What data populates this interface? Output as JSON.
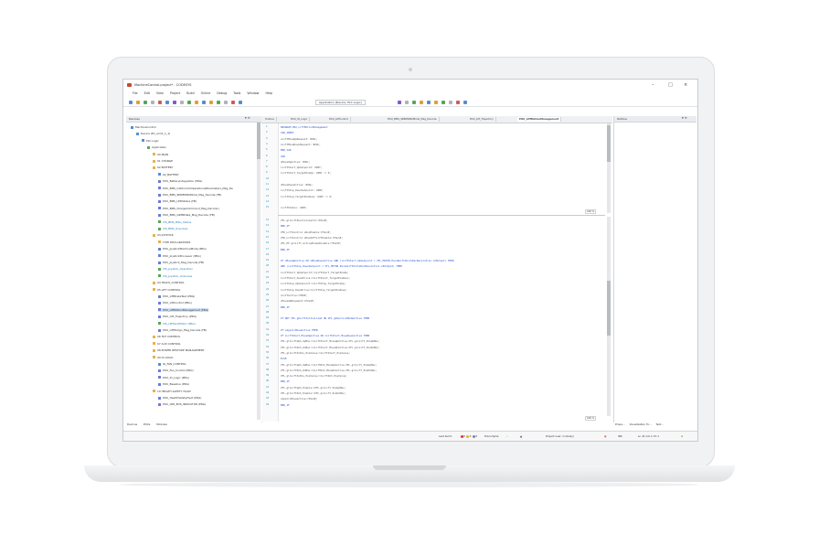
{
  "window": {
    "title": "MachineControl.project* - CODESYS",
    "controls": [
      "–",
      "□",
      "×"
    ]
  },
  "menu": [
    "File",
    "Edit",
    "View",
    "Project",
    "Build",
    "Online",
    "Debug",
    "Tools",
    "Window",
    "Help"
  ],
  "toolbar": {
    "application_selector": "Application [Device: PLC Logic]"
  },
  "devices_panel": {
    "title": "Devices",
    "tree": [
      {
        "label": "MachineControl",
        "icon": "project-icon",
        "indent": 0
      },
      {
        "label": "Device (E1_arm1_1_1)",
        "icon": "device-icon",
        "indent": 1
      },
      {
        "label": "PLC Logic",
        "icon": "plc-icon",
        "indent": 2
      },
      {
        "label": "Application",
        "icon": "app-icon",
        "indent": 3
      },
      {
        "label": "00 MAIN",
        "icon": "folder-icon",
        "indent": 4
      },
      {
        "label": "01 CHANGE",
        "icon": "folder-icon",
        "indent": 4
      },
      {
        "label": "02 BATTERY",
        "icon": "folder-icon",
        "indent": 4
      },
      {
        "label": "02_BATTERY",
        "icon": "gvl-icon",
        "indent": 5
      },
      {
        "label": "POU_BatteryIntegration (PRG)",
        "icon": "pou-icon",
        "indent": 5
      },
      {
        "label": "POU_BMS_CANcommOperationalParameters_Msg_De",
        "icon": "pou-icon",
        "indent": 5
      },
      {
        "label": "POU_BMS_SERIERNUMmal_Msg_Decode (FB)",
        "icon": "pou-icon",
        "indent": 5
      },
      {
        "label": "POU_BMS_LEDStatus (FB)",
        "icon": "pou-icon",
        "indent": 5
      },
      {
        "label": "POU_BMS_ChargeCommand_Msg_Decode (",
        "icon": "pou-icon",
        "indent": 5
      },
      {
        "label": "POU_BMS_GIMMDate_Msg_Decode (FB)",
        "icon": "pou-icon",
        "indent": 5
      },
      {
        "label": "VIS_BMS_MSG_Status",
        "icon": "vis-icon",
        "indent": 5
      },
      {
        "label": "VIS_BMS_Overview",
        "icon": "vis-icon",
        "indent": 5
      },
      {
        "label": "03 JOYSTICK",
        "icon": "folder-icon",
        "indent": 4
      },
      {
        "label": "TYPE DECLARATIONS",
        "icon": "folder-icon",
        "indent": 5
      },
      {
        "label": "POU_JoystickMachineMode (PRG)",
        "icon": "pou-icon",
        "indent": 5
      },
      {
        "label": "POU_JoystickProcessor (PRG)",
        "icon": "pou-icon",
        "indent": 5
      },
      {
        "label": "POU_Joystick_Msg_Decode (FB)",
        "icon": "pou-icon",
        "indent": 5
      },
      {
        "label": "VIS_Joystick_Operation",
        "icon": "vis-icon",
        "indent": 5
      },
      {
        "label": "VIS_Joystick_Overview",
        "icon": "vis-icon",
        "indent": 5
      },
      {
        "label": "04 TRACK_CONTROL",
        "icon": "folder-icon",
        "indent": 4
      },
      {
        "label": "05 LIFT CONTROL",
        "icon": "folder-icon",
        "indent": 4
      },
      {
        "label": "POU_LiftBrakeTest (PRG)",
        "icon": "pou-icon",
        "indent": 5
      },
      {
        "label": "POU_LiftControl (PRG)",
        "icon": "pou-icon",
        "indent": 5
      },
      {
        "label": "POU_LiftMotionManagement (PRG)",
        "icon": "pou-icon",
        "indent": 5,
        "selected": true
      },
      {
        "label": "POU_Lift_Trajectory (PRG)",
        "icon": "pou-icon",
        "indent": 5
      },
      {
        "label": "VIS_LiftHandMotor (PRG)",
        "icon": "vis-icon",
        "indent": 5
      },
      {
        "label": "POU_LiftWdrgo_Msg_Decode (FB)",
        "icon": "pou-icon",
        "indent": 5
      },
      {
        "label": "06 TILT CONTROL",
        "icon": "folder-icon",
        "indent": 4
      },
      {
        "label": "07 AUX CONTROL",
        "icon": "folder-icon",
        "indent": 4
      },
      {
        "label": "08 POWER RESTORE MANAGEMENT",
        "icon": "folder-icon",
        "indent": 4
      },
      {
        "label": "09 IO LOGIC",
        "icon": "folder-icon",
        "indent": 4
      },
      {
        "label": "IO_FAN_CONTROL",
        "icon": "gvl-icon",
        "indent": 5
      },
      {
        "label": "POU_Fan_Control (PRG)",
        "icon": "pou-icon",
        "indent": 5
      },
      {
        "label": "POU_IO_Logic (PRG)",
        "icon": "pou-icon",
        "indent": 5
      },
      {
        "label": "POU_Baseline (PRG)",
        "icon": "pou-icon",
        "indent": 5
      },
      {
        "label": "10 HEALTH SAFETY FAULT",
        "icon": "folder-icon",
        "indent": 4
      },
      {
        "label": "POU_HealthSafetyFault (PRG)",
        "icon": "pou-icon",
        "indent": 5
      },
      {
        "label": "POU_LED_BUS_INDICATOR (PRG)",
        "icon": "pou-icon",
        "indent": 5
      }
    ],
    "bottom_tabs": [
      "Devices",
      "POUs",
      "Modules"
    ]
  },
  "editor": {
    "tabs": [
      "Toolbox",
      "POU_IO_Logic",
      "POU_LiftControl",
      "POU_BMS_SERIERNUMmal_Msg_Decode",
      "POU_Lift_Trajectory",
      "POU_LiftMotionManagement"
    ],
    "active_tab": "POU_LiftMotionManagement",
    "zoom_top": "100 %",
    "zoom_bottom": "100 %",
    "decl_lines": [
      {
        "n": "1",
        "t": "PROGRAM POU_LiftMotionManagement",
        "c": "kw"
      },
      {
        "n": "2",
        "t": "VAR_INPUT",
        "c": "kw"
      },
      {
        "n": "3",
        "t": "    xLiftMoveUpRequest: BOOL;",
        "c": "tx"
      },
      {
        "n": "4",
        "t": "    xLiftMoveDownRequest: BOOL;",
        "c": "tx"
      },
      {
        "n": "5",
        "t": "END_VAR",
        "c": "kw"
      },
      {
        "n": "6",
        "t": "VAR",
        "c": "kw"
      },
      {
        "n": "7",
        "t": "    xMoveUpActive: BOOL;",
        "c": "tx"
      },
      {
        "n": "8",
        "t": "    iLiftStart_UpSetpoint: UINT;",
        "c": "tx"
      },
      {
        "n": "9",
        "t": "    iLiftStart_TargetPosUp: UINT := 0;",
        "c": "tx"
      },
      {
        "n": "10",
        "t": "",
        "c": "tx"
      },
      {
        "n": "11",
        "t": "    xMoveDownActive: BOOL;",
        "c": "tx"
      },
      {
        "n": "12",
        "t": "    iLiftStop_DownSetpoint: UINT;",
        "c": "tx"
      },
      {
        "n": "13",
        "t": "    iLiftStop_TargetPosDown: UINT := 0;",
        "c": "tx"
      },
      {
        "n": "14",
        "t": "",
        "c": "tx"
      },
      {
        "n": "15",
        "t": "    iLiftStatus: UINT;",
        "c": "tx"
      }
    ],
    "impl_lines": [
      {
        "n": "12",
        "t": "    VFL.gliLiftPositionLatch:=FALSE;",
        "c": "tx"
      },
      {
        "n": "13",
        "t": "    END_IF",
        "c": "kw"
      },
      {
        "n": "14",
        "t": "    VFD_LiftControl.xRunEnable:=FALSE;",
        "c": "tx"
      },
      {
        "n": "15",
        "t": "    VFD_LiftControl.xHandOffLiftEnable:=FALSE;",
        "c": "tx"
      },
      {
        "n": "16",
        "t": "    VFL_PF.gliLift_ActiveBrakeDisable:=FALSE;",
        "c": "tx"
      },
      {
        "n": "17",
        "t": "END_IF",
        "c": "kw"
      },
      {
        "n": "18",
        "t": "",
        "c": "tx"
      },
      {
        "n": "19",
        "t": "IF xMoveUpActive OR xMoveDownActive AND (iLiftStart_UpSetpoint > VFL_MOTOR.ParamLiftUnitsPerRevolution.xIOutput) THEN",
        "c": "kw"
      },
      {
        "n": "20",
        "t": "                                   AND (iLiftStop_DownSetpoint < VFL_MOTOR.ParamLiftUnitsPerRevolution.xIOutput) THEN",
        "c": "kw"
      },
      {
        "n": "21",
        "t": "    iLiftStart_UpSetpoint:=iLiftStart_TargetPosUp;",
        "c": "tx"
      },
      {
        "n": "22",
        "t": "    iLiftStart_DownDrive:=iLiftStart_TargetPosDown;",
        "c": "tx"
      },
      {
        "n": "23",
        "t": "    iLiftStop_UpSetpoint:=iLiftStop_TargetPosUp;",
        "c": "tx"
      },
      {
        "n": "24",
        "t": "    iLiftStop_DownDrive:=iLiftStop_TargetPosDown;",
        "c": "tx"
      },
      {
        "n": "25",
        "t": "    xLiftActive:=TRUE;",
        "c": "tx"
      },
      {
        "n": "26",
        "t": "    xMoveUpMovement:=FALSE;",
        "c": "tx"
      },
      {
        "n": "27",
        "t": "END_IF",
        "c": "kw"
      },
      {
        "n": "28",
        "t": "",
        "c": "tx"
      },
      {
        "n": "29",
        "t": "IF NOT VFL.gbLiftInitialized OR VFL.gbServiceModeActive THEN",
        "c": "kw"
      },
      {
        "n": "30",
        "t": "",
        "c": "tx"
      },
      {
        "n": "31",
        "t": "    IF xApplicMoveActive THEN",
        "c": "kw"
      },
      {
        "n": "32",
        "t": "        IF iLiftStart_MoveUpActive OR iLiftStart_MoveDownActive THEN",
        "c": "kw"
      },
      {
        "n": "33",
        "t": "            VFL.gliLiftUpS_UpMax:=iLiftStart_MoveUpActive-VFL.gliLift_PosUpMax;",
        "c": "tx"
      },
      {
        "n": "34",
        "t": "            VFL.gliLiftDnS_DnMax:=iLiftStart_MoveDnActive-VFL.gliLift_PosDnMax;",
        "c": "tx"
      },
      {
        "n": "35",
        "t": "            VFL.gliLiftInPos_PosValue:=iLiftStart_PosValue;",
        "c": "tx"
      },
      {
        "n": "36",
        "t": "        ELSE",
        "c": "kw"
      },
      {
        "n": "37",
        "t": "            VFL.gliLiftUpS_UpMax:=iLiftDnS_MoveUpActive-VFL.gliLift_PosUpMax;",
        "c": "tx"
      },
      {
        "n": "38",
        "t": "            VFL.gliLiftDnS_DnMax:=iLiftDnS_MoveDnActive-VFL.gliLift_PosDnMax;",
        "c": "tx"
      },
      {
        "n": "39",
        "t": "            VFL.gliLiftInPos_PosValue:=iLiftDnS_PosValue;",
        "c": "tx"
      },
      {
        "n": "40",
        "t": "        END_IF",
        "c": "kw"
      },
      {
        "n": "41",
        "t": "        VFL.gliLiftUpS_Enable:=VFL.gliLift_PosUpMax;",
        "c": "tx"
      },
      {
        "n": "42",
        "t": "        VFL.gliLiftDnS_Enable:=VFL.gliLift_PosDnMax;",
        "c": "tx"
      },
      {
        "n": "43",
        "t": "        xApplicMoveActive:=FALSE;",
        "c": "tx"
      },
      {
        "n": "44",
        "t": "    END_IF",
        "c": "kw"
      }
    ]
  },
  "outline_panel": {
    "title": "Outline",
    "bottom_tabs": [
      "Prope...",
      "Visualization To...",
      "Text..."
    ]
  },
  "statusbar": {
    "last_build": "Last build:",
    "errors": "0",
    "warnings": "0",
    "messages": "0",
    "precompile": "Precompile",
    "project_user": "Project user: (nobody)",
    "ins": "INS",
    "position": "Ln 41   Col 1   Ch 1"
  },
  "colors": {
    "keyword": "#2a4fd0",
    "selection": "#cfe0f5",
    "error_dot": "#d63a3a",
    "warning_dot": "#e8b523",
    "precompile_ok": "#3fa34d"
  }
}
